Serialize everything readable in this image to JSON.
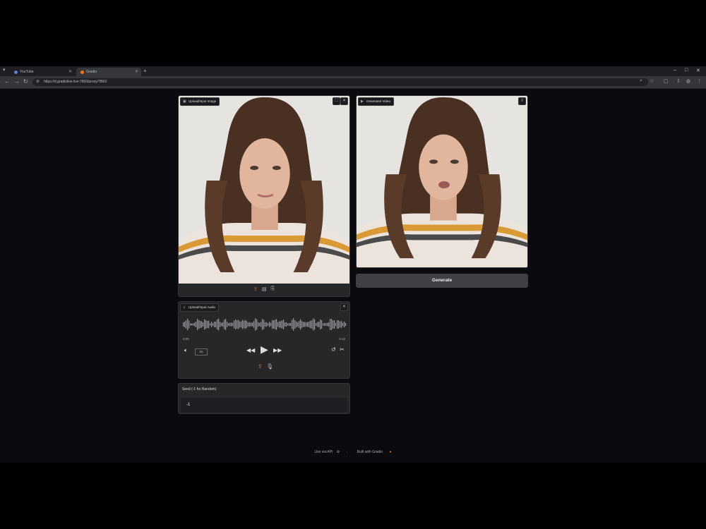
{
  "browser": {
    "tabs": [
      {
        "label": "YouTube",
        "active": false
      },
      {
        "label": "Gradio",
        "active": true
      }
    ],
    "url": "https://d.gradiolive.live:7860/proxy/7860/",
    "new_tab": "+",
    "window_controls": [
      "–",
      "□",
      "✕"
    ]
  },
  "input_image": {
    "label": "Upload/Input Image",
    "tools": [
      "upload-icon",
      "clipboard-icon",
      "paste-icon"
    ]
  },
  "output_video": {
    "label": "Generated Video"
  },
  "generate_button": "Generate",
  "audio": {
    "label": "Upload/Input Audio",
    "time_start": "0:00",
    "time_end": "0:12",
    "speed": "1x"
  },
  "seed": {
    "label": "Seed (-1 for Random)",
    "value": "-1"
  },
  "footer": {
    "api": "Use via API",
    "built": "Built with Gradio"
  },
  "colors": {
    "accent": "#f97316",
    "background": "#0b0b0f",
    "panel": "#27272a"
  }
}
